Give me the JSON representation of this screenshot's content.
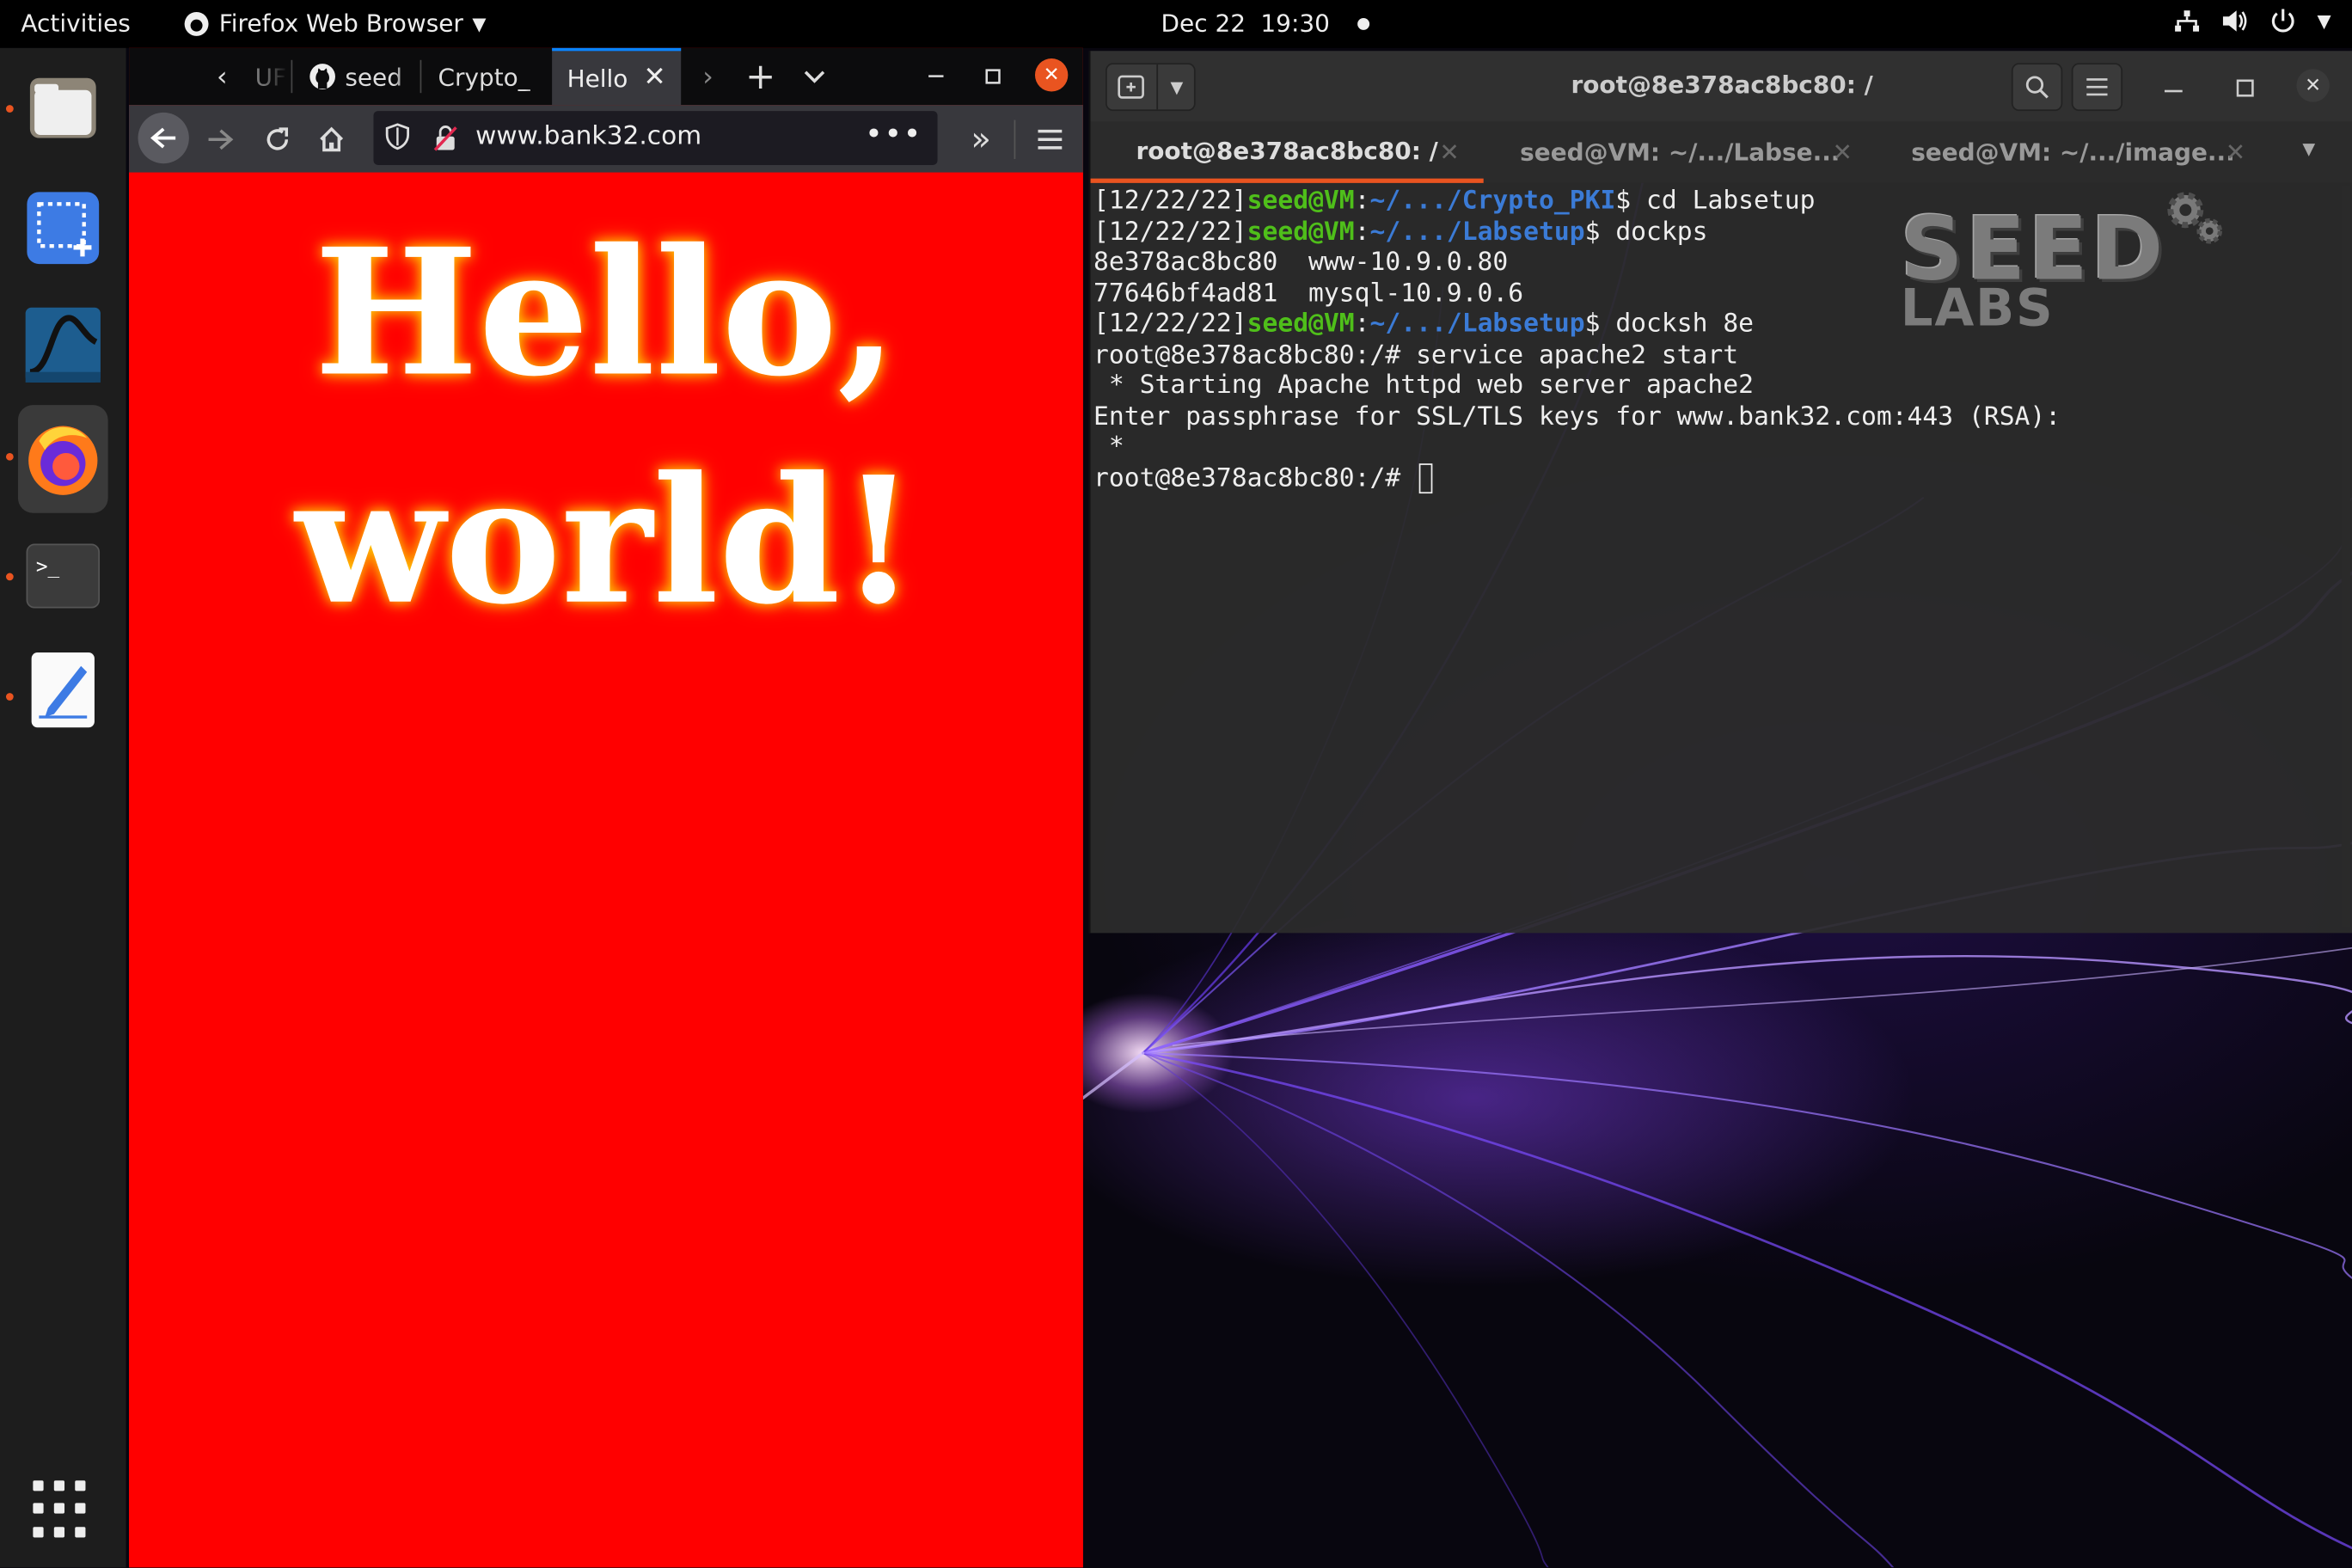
{
  "topbar": {
    "activities": "Activities",
    "app_name": "Firefox Web Browser",
    "date": "Dec 22",
    "time": "19:30"
  },
  "dock": {
    "items": [
      "files-icon",
      "screenshot-icon",
      "wireshark-icon",
      "firefox-icon",
      "terminal-icon",
      "text-editor-icon"
    ],
    "show_apps": "show-applications-icon"
  },
  "firefox": {
    "tabs": [
      {
        "label": "UF",
        "icon": "page-icon"
      },
      {
        "label": "seed",
        "icon": "github-icon"
      },
      {
        "label": "Crypto_",
        "icon": ""
      },
      {
        "label": "Hello",
        "icon": ""
      }
    ],
    "url": "www.bank32.com",
    "page_text_line1": "Hello,",
    "page_text_line2": "world!"
  },
  "terminal": {
    "title": "root@8e378ac8bc80: /",
    "tabs": [
      {
        "label": "root@8e378ac8bc80: /"
      },
      {
        "label": "seed@VM: ~/.../Labse..."
      },
      {
        "label": "seed@VM: ~/.../image..."
      }
    ],
    "lines": [
      {
        "date": "[12/22/22]",
        "user": "seed@VM",
        "sep": ":",
        "path": "~/.../Crypto_PKI",
        "rest": "$ cd Labsetup"
      },
      {
        "date": "[12/22/22]",
        "user": "seed@VM",
        "sep": ":",
        "path": "~/.../Labsetup",
        "rest": "$ dockps"
      },
      {
        "text": "8e378ac8bc80  www-10.9.0.80"
      },
      {
        "text": "77646bf4ad81  mysql-10.9.0.6"
      },
      {
        "date": "[12/22/22]",
        "user": "seed@VM",
        "sep": ":",
        "path": "~/.../Labsetup",
        "rest": "$ docksh 8e"
      },
      {
        "text": "root@8e378ac8bc80:/# service apache2 start"
      },
      {
        "text": " * Starting Apache httpd web server apache2"
      },
      {
        "text": "Enter passphrase for SSL/TLS keys for www.bank32.com:443 (RSA):"
      },
      {
        "text": " *"
      },
      {
        "text": "root@8e378ac8bc80:/# "
      }
    ],
    "logo_big": "SEED",
    "logo_small": "LABS"
  },
  "colors": {
    "accent": "#e95420",
    "page_bg": "#ff0000",
    "prompt_user": "#4fbf1a",
    "prompt_path": "#3b7bd6"
  }
}
